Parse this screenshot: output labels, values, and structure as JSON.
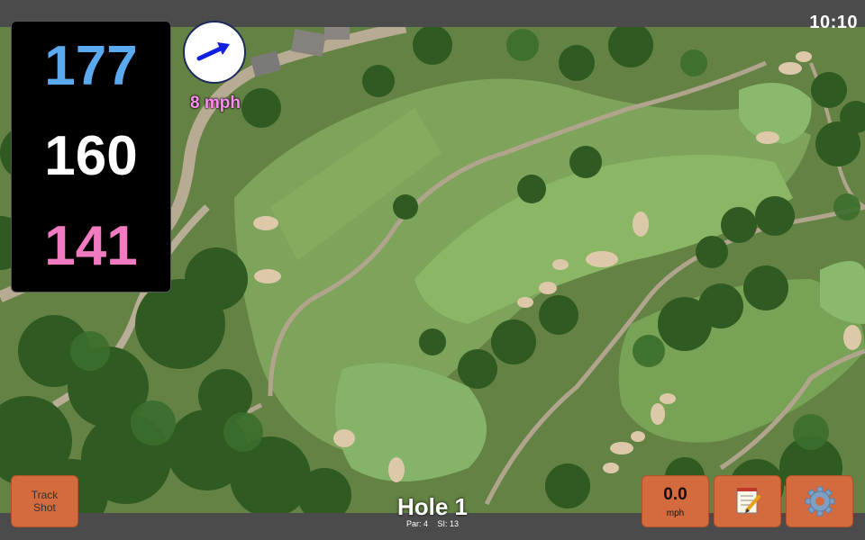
{
  "status_bar": {
    "time": "10:10"
  },
  "yardages": {
    "back": "177",
    "middle": "160",
    "front": "141"
  },
  "wind": {
    "speed_label": "8 mph",
    "direction_icon": "arrow-icon"
  },
  "buttons": {
    "track_shot_line1": "Track",
    "track_shot_line2": "Shot",
    "wind_value": "0.0",
    "wind_unit": "mph",
    "notes_icon": "notepad-icon",
    "settings_icon": "gear-icon"
  },
  "hole": {
    "title": "Hole 1",
    "par_label": "Par: 4",
    "si_label": "SI: 13"
  },
  "colors": {
    "back_yardage": "#5aaaf0",
    "middle_yardage": "#ffffff",
    "front_yardage": "#f07bc0",
    "button_orange": "#d46b3f",
    "wind_text": "#ff8cf0"
  }
}
